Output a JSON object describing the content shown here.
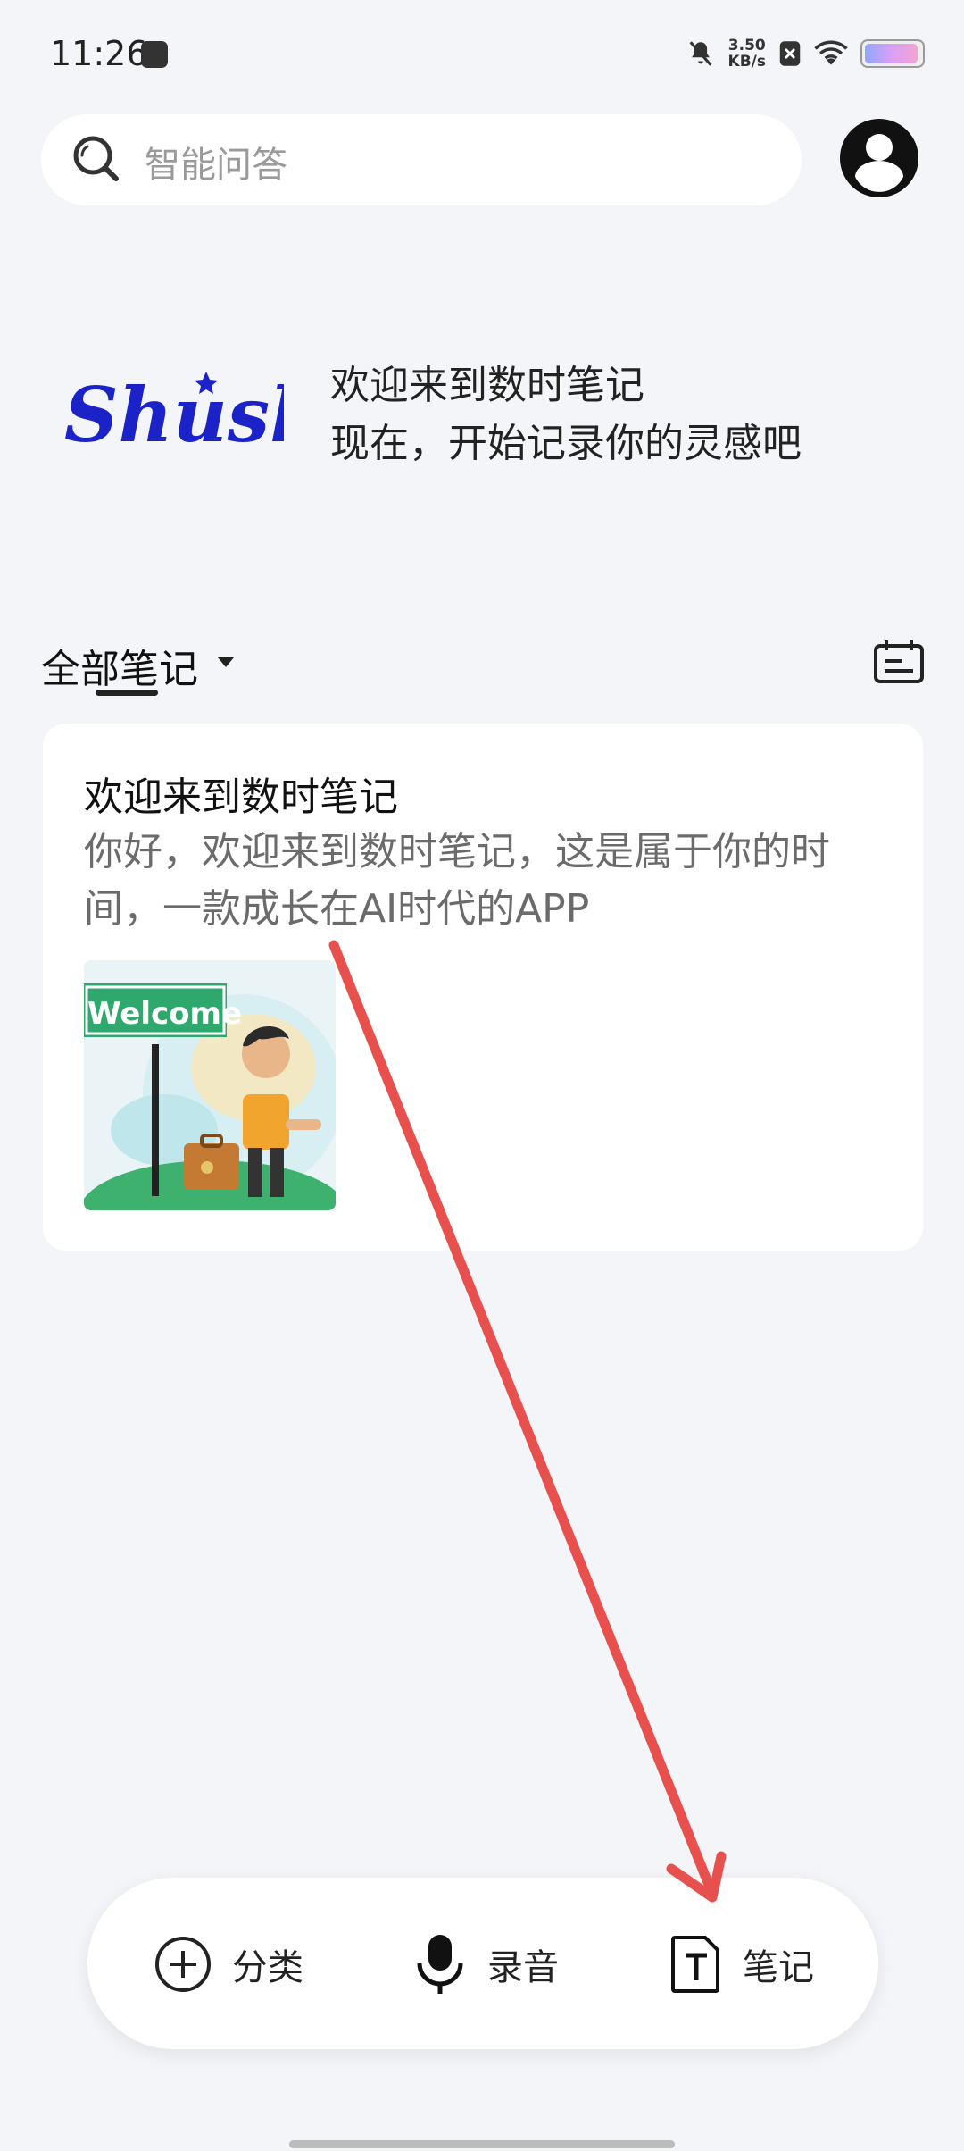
{
  "status_bar": {
    "time": "11:26",
    "net_speed_value": "3.50",
    "net_speed_unit": "KB/s",
    "battery_level": 0.95
  },
  "search": {
    "placeholder": "智能问答"
  },
  "welcome": {
    "logo_text": "Shushi",
    "line1": "欢迎来到数时笔记",
    "line2": "现在，开始记录你的灵感吧"
  },
  "notes": {
    "filter_label": "全部笔记",
    "items": [
      {
        "title": "欢迎来到数时笔记",
        "body": "你好，欢迎来到数时笔记，这是属于你的时间，一款成长在AI时代的APP",
        "image_sign_text": "Welcome"
      }
    ]
  },
  "bottom_bar": {
    "category_label": "分类",
    "record_label": "录音",
    "note_label": "笔记"
  },
  "colors": {
    "background": "#f4f5f8",
    "logo_blue": "#1a22c8",
    "annotation_red": "#e8504e"
  },
  "icons": [
    "search-icon",
    "avatar-icon",
    "calendar-icon",
    "add-circle-icon",
    "microphone-icon",
    "text-note-icon"
  ]
}
